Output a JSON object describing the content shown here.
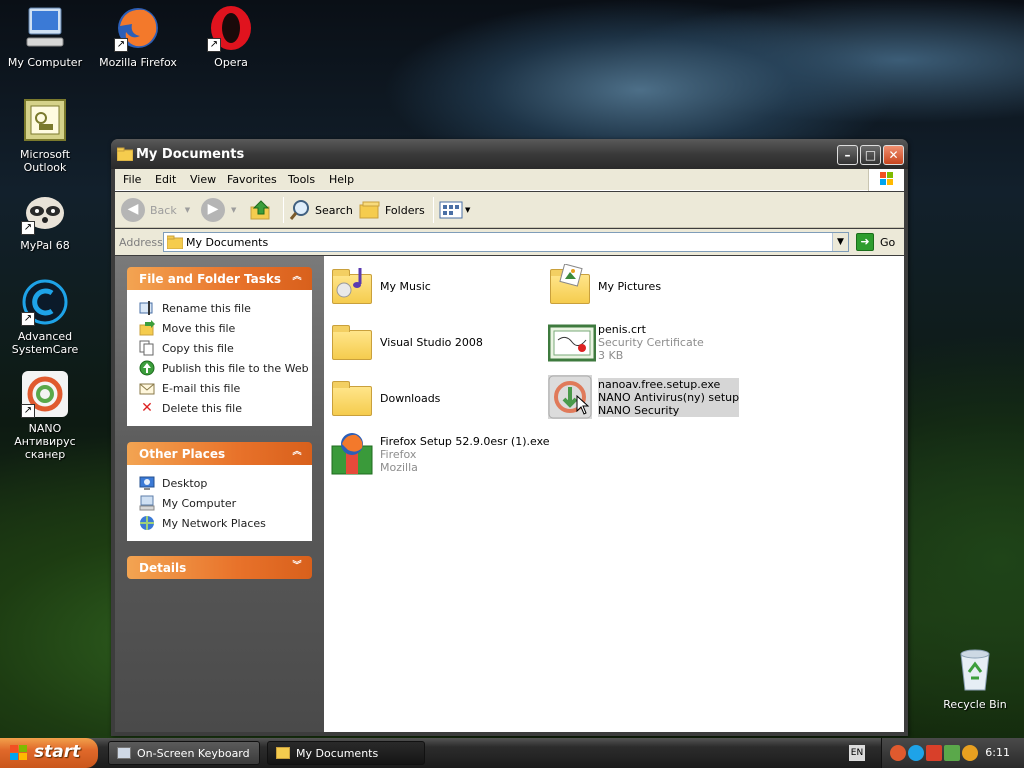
{
  "desktop": {
    "icons": [
      {
        "label": "My Computer"
      },
      {
        "label": "Mozilla Firefox"
      },
      {
        "label": "Opera"
      },
      {
        "label": "Microsoft Outlook"
      },
      {
        "label": "MyPal 68"
      },
      {
        "label": "Advanced SystemCare"
      },
      {
        "label": "NANO Антивирус сканер"
      },
      {
        "label": "Recycle Bin"
      }
    ]
  },
  "window": {
    "title": "My Documents",
    "menu": [
      "File",
      "Edit",
      "View",
      "Favorites",
      "Tools",
      "Help"
    ],
    "toolbar": {
      "back": "Back",
      "search": "Search",
      "folders": "Folders"
    },
    "address": {
      "label": "Address",
      "value": "My Documents",
      "go": "Go"
    },
    "taskpane": {
      "file_tasks": {
        "title": "File and Folder Tasks",
        "items": [
          "Rename this file",
          "Move this file",
          "Copy this file",
          "Publish this file to the Web",
          "E-mail this file",
          "Delete this file"
        ]
      },
      "other_places": {
        "title": "Other Places",
        "items": [
          "Desktop",
          "My Computer",
          "My Network Places"
        ]
      },
      "details": {
        "title": "Details"
      }
    },
    "files": [
      {
        "name": "My Music"
      },
      {
        "name": "My Pictures"
      },
      {
        "name": "Visual Studio 2008"
      },
      {
        "name": "penis.crt",
        "line2": "Security Certificate",
        "line3": "3 KB"
      },
      {
        "name": "Downloads"
      },
      {
        "name": "nanoav.free.setup.exe",
        "line2": "NANO Antivirus(ny) setup",
        "line3": "NANO Security"
      },
      {
        "name": "Firefox Setup 52.9.0esr (1).exe",
        "line2": "Firefox",
        "line3": "Mozilla"
      }
    ]
  },
  "taskbar": {
    "start": "start",
    "buttons": [
      "On-Screen Keyboard",
      "My Documents"
    ],
    "lang": "EN",
    "clock": "6:11"
  },
  "colors": {
    "accent_orange": "#e8722a",
    "window_chrome": "#3d3d3d",
    "selection": "#d6d6d6"
  }
}
